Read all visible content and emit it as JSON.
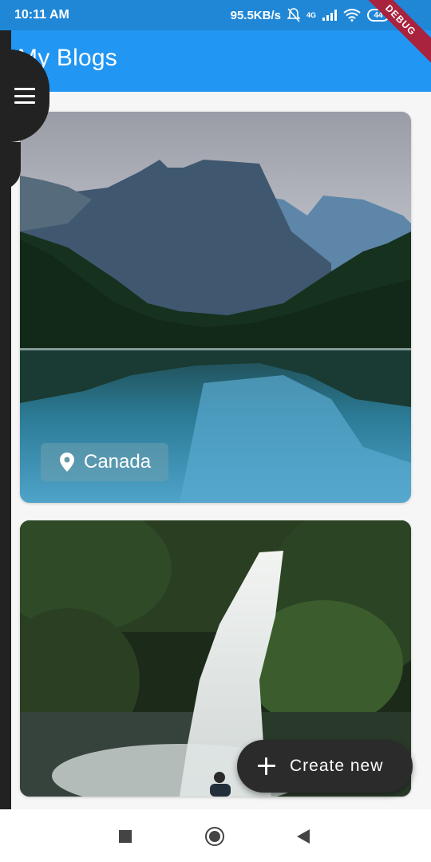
{
  "status_bar": {
    "time": "10:11 AM",
    "speed": "95.5KB/s",
    "network": "4G",
    "battery": "44"
  },
  "debug_banner": "DEBUG",
  "app_bar": {
    "title": "My Blogs"
  },
  "drawer": {
    "icon": "menu-icon"
  },
  "cards": [
    {
      "location": "Canada",
      "icon": "map-pin-icon"
    },
    {
      "location": ""
    }
  ],
  "fab": {
    "label": "Create new",
    "icon": "plus-icon"
  },
  "nav_bar": {
    "icons": [
      "recent-apps-icon",
      "home-icon",
      "back-icon"
    ]
  }
}
